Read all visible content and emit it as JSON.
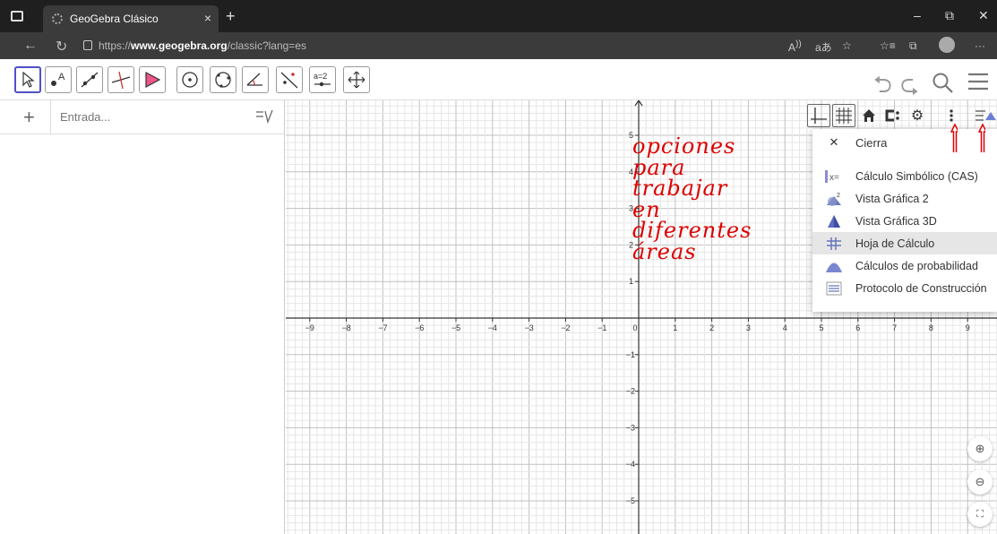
{
  "browser": {
    "tab_title": "GeoGebra Clásico",
    "tab_close": "×",
    "new_tab": "+",
    "url_prefix": "https://",
    "url_domain": "www.geogebra.org",
    "url_path": "/classic?lang=es",
    "read_aloud": "Á)",
    "translate": "aあ",
    "more": "···"
  },
  "algebra": {
    "add": "+",
    "input_placeholder": "Entrada..."
  },
  "menu": {
    "close_label": "Cierra",
    "items": [
      "Cálculo Simbólico (CAS)",
      "Vista Gráfica 2",
      "Vista Gráfica 3D",
      "Hoja de Cálculo",
      "Cálculos de probabilidad",
      "Protocolo de Construcción"
    ]
  },
  "annotation": {
    "text": "opciones\npara\ntrabajar\nen\ndiferentes\náreas"
  },
  "axes": {
    "x_ticks": [
      "−9",
      "−8",
      "−7",
      "−6",
      "−5",
      "−4",
      "−3",
      "−2",
      "−1",
      "0",
      "1",
      "2",
      "3",
      "4",
      "5",
      "6",
      "7",
      "8",
      "9"
    ],
    "y_ticks_pos": [
      "5",
      "4",
      "3",
      "2",
      "1"
    ],
    "y_ticks_neg": [
      "−1",
      "−2",
      "−3",
      "−4",
      "−5"
    ]
  },
  "colors": {
    "annotation": "#dd0000",
    "selection": "#5050c8"
  }
}
